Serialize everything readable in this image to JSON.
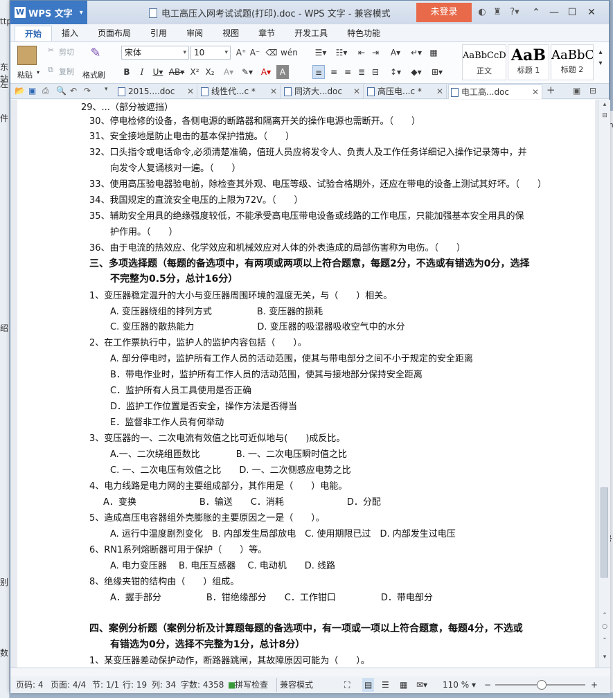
{
  "background": {
    "left_fragments": [
      "ttp",
      "东站",
      "左",
      "件",
      "绍",
      "别",
      "数"
    ],
    "right_fragments": [
      "sh",
      "e",
      "号"
    ]
  },
  "titlebar": {
    "app_name": "WPS 文字",
    "doc_title": "电工高压入网考试试题(打印).doc - WPS 文字 - 兼容模式",
    "login_label": "未登录"
  },
  "menu": {
    "tabs": [
      "开始",
      "插入",
      "页面布局",
      "引用",
      "审阅",
      "视图",
      "章节",
      "开发工具",
      "特色功能"
    ],
    "active": "开始"
  },
  "ribbon": {
    "paste_label": "粘贴",
    "cut_label": "剪切",
    "copy_label": "复制",
    "format_painter_label": "格式刷",
    "font_name": "宋体",
    "font_size": "10",
    "styles": [
      {
        "sample": "AaBbCcD",
        "name": "正文"
      },
      {
        "sample": "AaB",
        "name": "标题 1"
      },
      {
        "sample": "AaBbC",
        "name": "标题 2"
      }
    ]
  },
  "doc_tabs": [
    {
      "label": "2015....doc",
      "active": false,
      "modified": false
    },
    {
      "label": "线性代...c *",
      "active": false,
      "modified": true
    },
    {
      "label": "同济大...doc",
      "active": false,
      "modified": false
    },
    {
      "label": "高压电...c *",
      "active": false,
      "modified": true
    },
    {
      "label": "电工高...doc",
      "active": true,
      "modified": false
    }
  ],
  "document": {
    "lines": [
      "29、...（部分被遮挡）",
      "30、停电检修的设备，各侧电源的断路器和隔离开关的操作电源也需断开。（　　）",
      "31、安全接地是防止电击的基本保护措施。（　　）",
      "32、口头指令或电话命令,必须清楚准确，值班人员应将发令人、负责人及工作任务详细记入操作记录簿中，并",
      "向发令人复诵核对一遍。（　　）",
      "33、使用高压验电器验电前，除检查其外观、电压等级、试验合格期外，还应在带电的设备上测试其好坏。（　　）",
      "34、我国规定的直流安全电压的上限为72V。（　　）",
      "35、辅助安全用具的绝缘强度较低，不能承受高电压带电设备或线路的工作电压，只能加强基本安全用具的保",
      "护作用。（　　）",
      "36、由于电流的热效应、化学效应和机械效应对人体的外表造成的局部伤害称为电伤。（　　）",
      "三、多项选择题（每题的备选项中，有两项或两项以上符合题意，每题2分，不选或有错选为0分，选择",
      "不完整为0.5分，总计16分）",
      "1、变压器稳定温升的大小与变压器周围环境的温度无关，与（　　）相关。",
      "A. 变压器绕组的排列方式　　　　　B. 变压器的损耗",
      "C. 变压器的散热能力　　　　　　　D. 变压器的吸湿器吸收空气中的水分",
      "2、在工作票执行中，监护人的监护内容包括（　　）。",
      "A. 部分停电时，监护所有工作人员的活动范围，使其与带电部分之间不小于规定的安全距离",
      "B．带电作业时，监护所有工作人员的活动范围，使其与接地部分保持安全距离",
      "C．监护所有人员工具使用是否正确",
      "D．监护工作位置是否安全，操作方法是否得当",
      "E．监督非工作人员有何举动",
      "3、变压器的一、二次电流有效值之比可近似地与(　　)成反比。",
      "A.一、二次绕组匝数比　　　　B. 一、二次电压瞬时值之比",
      "C. 一、二次电压有效值之比　　D. 一、二次侧感应电势之比",
      "4、电力线路是电力网的主要组成部分，其作用是（　　）电能。",
      "A．变换　　　　　　　B．输送　　C．消耗　　　　　　　D．分配",
      "5、造成高压电容器组外壳膨胀的主要原因之一是（　　）。",
      "A. 运行中温度剧烈变化　B. 内部发生局部放电　C. 使用期限已过　D. 内部发生过电压",
      "6、RN1系列熔断器可用于保护（　　）等。",
      "A. 电力变压器　 B. 电压互感器　 C. 电动机　　D. 线路",
      "8、绝缘夹钳的结构由（　　）组成。",
      "A．握手部分　　　　　B．钳绝缘部分　　C．工作钳口　　　　　D．带电部分",
      "四、案例分析题（案例分析及计算题每题的备选项中，有一项或一项以上符合题意，每题4分，不选或",
      "有错选为0分，选择不完整为1分，总计8分）",
      "1、某变压器差动保护动作，断路器跳闸，其故障原因可能为（　　）。"
    ]
  },
  "statusbar": {
    "page": "页码: 4",
    "pages": "页面: 4/4",
    "section": "节: 1/1",
    "row": "行: 19",
    "col": "列: 34",
    "wordcount": "字数: 4358",
    "spellcheck": "拼写检查",
    "mode": "兼容模式",
    "zoom": "110 %"
  }
}
